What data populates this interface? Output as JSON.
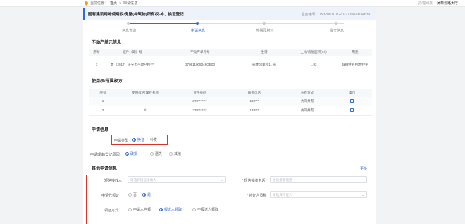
{
  "topbar": {
    "location_label": "当前位置：",
    "home": "首页",
    "sep": ">",
    "current": "申请信息",
    "right_link": "办理网点",
    "user": "吴泰淞路大厅"
  },
  "header": {
    "title": "国有建设用地使用权/房屋(构筑物)所有权-补、换证登记",
    "business_no": "业务编号：  W37081107-20221108-00346391"
  },
  "steps": [
    "信息查询",
    "申请信息",
    "签署及材料",
    "提交信息"
  ],
  "active_step": 1,
  "property_section": {
    "title": "不动产单元信息",
    "columns": [
      "序号",
      "证件（期）号",
      "不动产单元号",
      "坐落",
      "土地/房屋面积(m²)",
      "用途"
    ],
    "rows": [
      {
        "no": "1",
        "cert": "鲁（2017）济宁市不动产权***",
        "unit": "370811005046GB00",
        "location": "号楼02单元1...号",
        "area": "...93",
        "use": "城镇住宅用地/住宅"
      }
    ]
  },
  "owner_section": {
    "title": "使用权/所属权方",
    "columns": [
      "序号",
      "使用权/所属权名称",
      "证件号码",
      "联系电话",
      "共有方式",
      "操作"
    ],
    "rows": [
      {
        "no": "1",
        "name": "-",
        "id": "370*******",
        "phone": "139***",
        "share": "共同共有"
      },
      {
        "no": "2",
        "name": "*l",
        "id": "370*******",
        "phone": "138***",
        "share": "共同共有"
      }
    ]
  },
  "apply_section": {
    "title": "申请信息",
    "type_label": "申请类型",
    "type_options": [
      "换证",
      "补发"
    ],
    "type_selected": 0,
    "reason_label": "申请理由(登记原因)",
    "reason_options": [
      "破损",
      "遗失",
      "其他"
    ],
    "reason_selected": 0
  },
  "other_section": {
    "title": "其他申请信息",
    "more": "更多",
    "sms_receiver_label": "短信接收人",
    "sms_receiver_placeholder": "请选择短信接收人",
    "sms_phone_label": "* 短信接收电话",
    "sms_phone_placeholder": "短信接收电话",
    "proxy_label": "申请代领证",
    "proxy_options": [
      "否",
      "是"
    ],
    "proxy_selected": 1,
    "receiver_label": "* 持证人员称",
    "receiver_placeholder": "请选择持证人",
    "pickup_label": "领证方式",
    "pickup_options": [
      "申请人自领",
      "报送人领取",
      "不报送人领取"
    ],
    "pickup_selected": 1
  },
  "colors": {
    "accent": "#2f6bd8",
    "highlight_box": "#d9332a"
  }
}
